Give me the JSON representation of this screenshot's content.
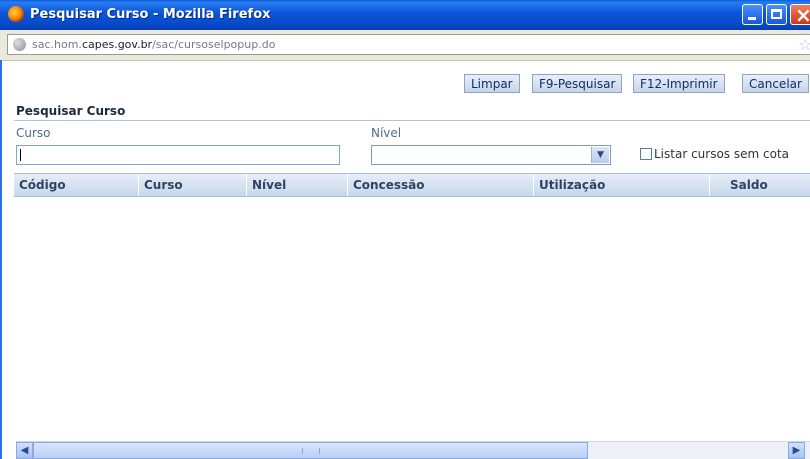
{
  "window": {
    "title": "Pesquisar Curso - Mozilla Firefox"
  },
  "urlbar": {
    "url_prefix": "sac.hom.",
    "url_domain": "capes.gov.br",
    "url_path": "/sac/cursoselpopup.do"
  },
  "toolbar": {
    "limpar": "Limpar",
    "pesquisar": "F9-Pesquisar",
    "imprimir": "F12-Imprimir",
    "cancelar": "Cancelar"
  },
  "form": {
    "title": "Pesquisar Curso",
    "curso_label": "Curso",
    "curso_value": "",
    "nivel_label": "Nível",
    "nivel_value": "",
    "checkbox_label": "Listar cursos sem cota",
    "checkbox_checked": false
  },
  "table": {
    "columns": [
      "Código",
      "Curso",
      "Nível",
      "Concessão",
      "Utilização",
      "Saldo"
    ],
    "rows": []
  },
  "colors": {
    "titlebar": "#0b58d8",
    "header_text": "#2d4560",
    "accent": "#4d6e8c"
  }
}
